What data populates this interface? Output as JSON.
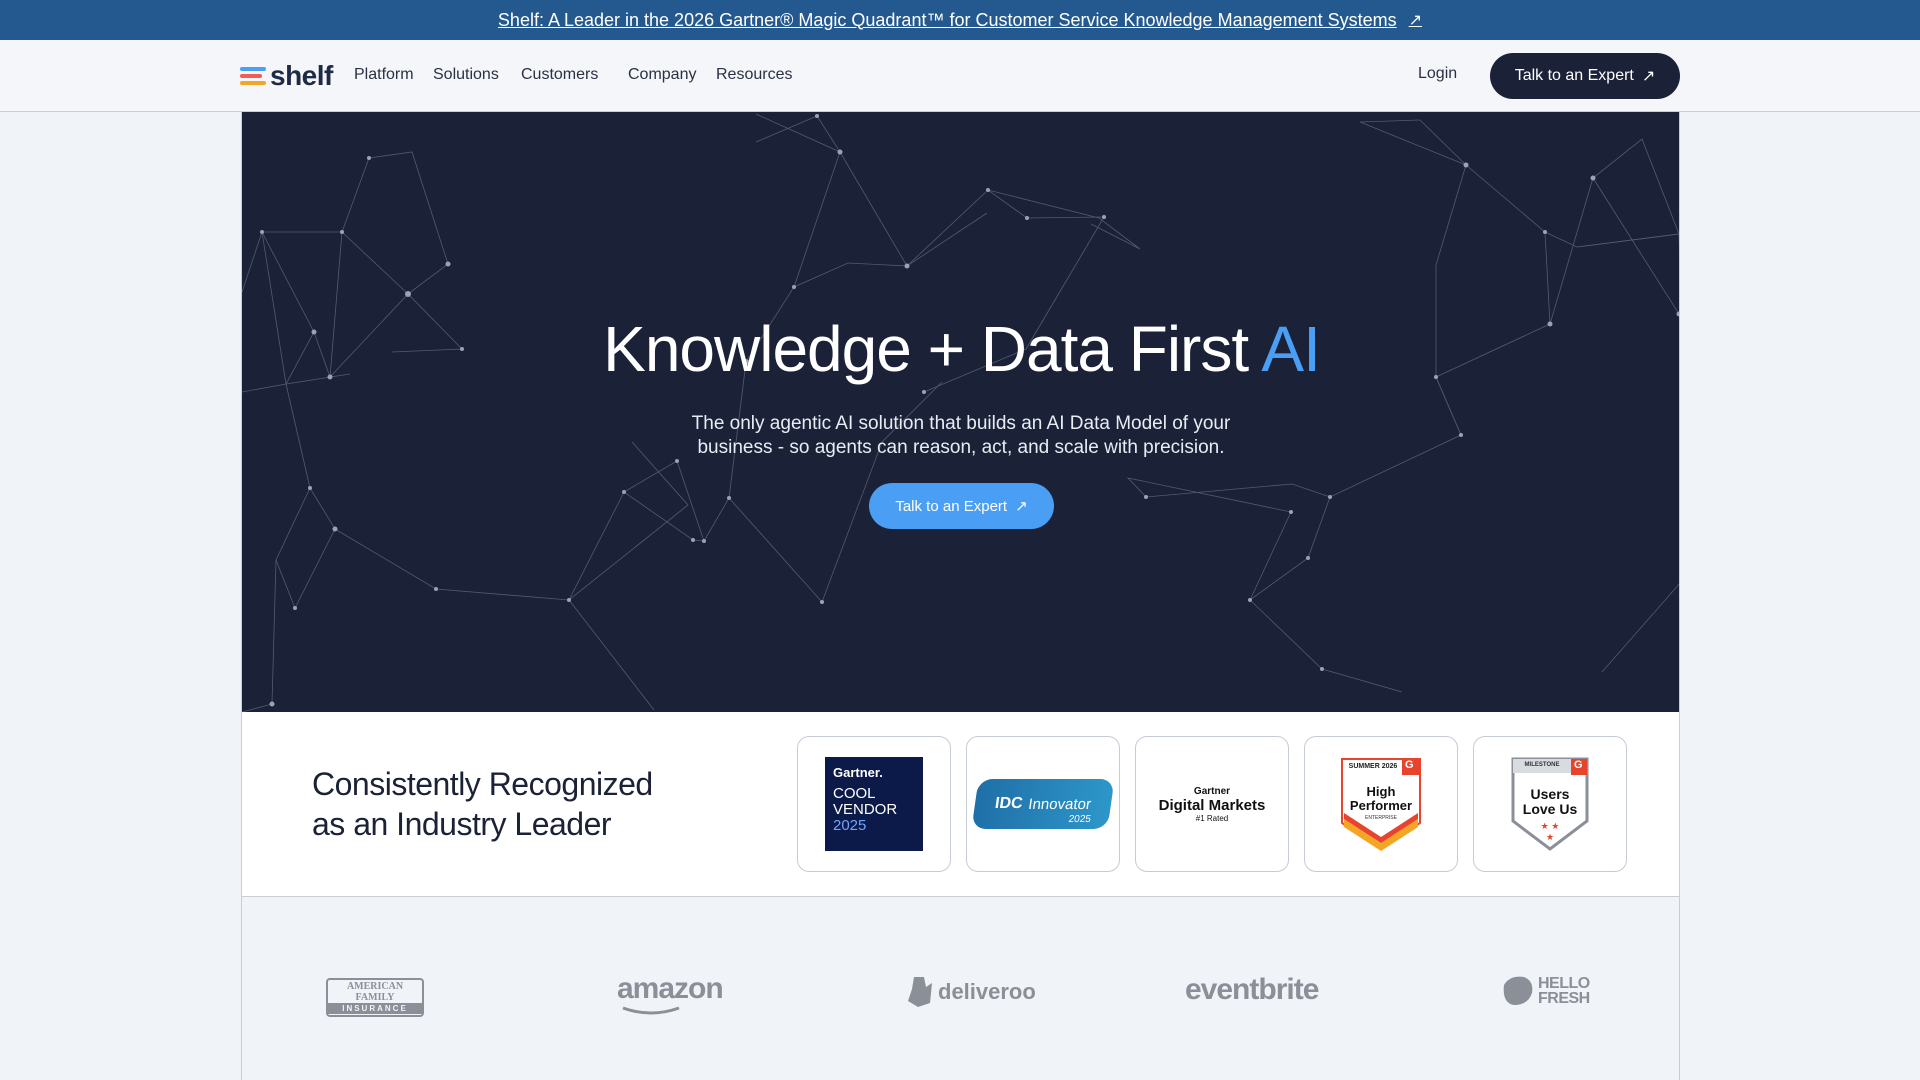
{
  "banner": {
    "text": "Shelf: A Leader in the 2026 Gartner® Magic Quadrant™ for Customer Service Knowledge Management Systems",
    "arrow": "↗"
  },
  "nav": {
    "logo_text": "shelf",
    "items": [
      "Platform",
      "Solutions",
      "Customers",
      "Company",
      "Resources"
    ],
    "login": "Login",
    "cta": "Talk to an Expert",
    "cta_arrow": "↗"
  },
  "hero": {
    "title_main": "Knowledge + Data First ",
    "title_accent": "AI",
    "subtitle": "The only agentic AI solution that builds an AI Data Model of your business - so agents can reason, act, and scale with precision.",
    "cta": "Talk to an Expert",
    "cta_arrow": "↗"
  },
  "recognition": {
    "title": "Consistently Recognized as an Industry Leader",
    "badges": [
      {
        "name": "gartner-cool-vendor",
        "lines": [
          "Gartner.",
          "COOL",
          "VENDOR",
          "2025"
        ]
      },
      {
        "name": "idc-innovator",
        "lines": [
          "IDC",
          "Innovator",
          "2025"
        ]
      },
      {
        "name": "gartner-digital-markets",
        "lines": [
          "Gartner",
          "Digital Markets",
          "#1 Rated"
        ]
      },
      {
        "name": "g2-high-performer",
        "lines": [
          "SUMMER 2026",
          "High",
          "Performer",
          "ENTERPRISE"
        ]
      },
      {
        "name": "g2-users-love-us",
        "lines": [
          "MILESTONE",
          "Users",
          "Love Us"
        ]
      }
    ]
  },
  "customers": [
    "AMERICAN FAMILY",
    "INSURANCE",
    "amazon",
    "deliveroo",
    "eventbrite",
    "HELLO",
    "FRESH"
  ],
  "colors": {
    "banner": "#245990",
    "navy": "#1b2238",
    "accent": "#4a9ff5",
    "g2_red": "#e8432c"
  }
}
